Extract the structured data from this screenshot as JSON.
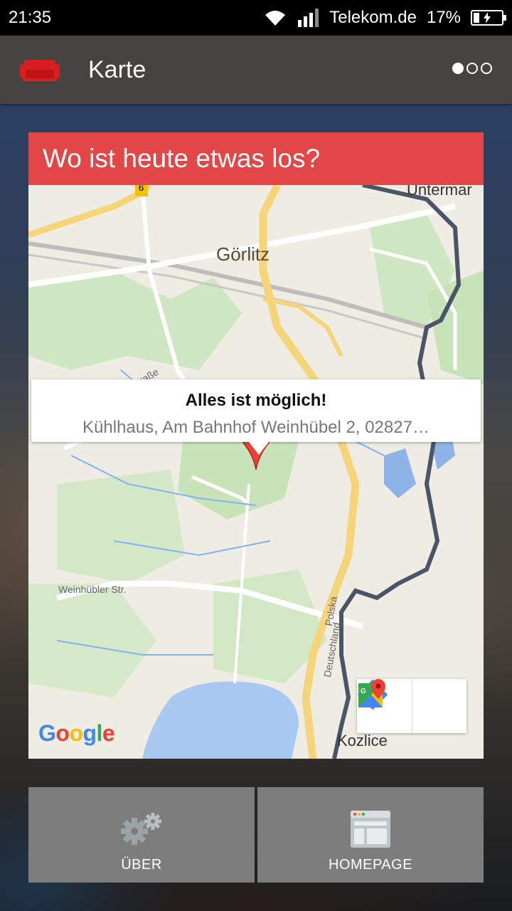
{
  "status_bar": {
    "time": "21:35",
    "carrier": "Telekom.de",
    "battery": "17%"
  },
  "action_bar": {
    "title": "Karte",
    "app_icon": "sofa-icon",
    "page_indicator": {
      "count": 3,
      "active": 1
    }
  },
  "card": {
    "title": "Wo ist heute etwas los?"
  },
  "map": {
    "info_window": {
      "title": "Alles ist möglich!",
      "address": "Kühlhaus, Am Bahnhof Weinhübel 2, 02827…"
    },
    "labels": {
      "city": "Görlitz",
      "town": "Kozlice",
      "poi": "Untermar",
      "street_1": "Promenadenstraße",
      "street_2": "Weinhübler Str.",
      "border_de": "Deutschland",
      "border_pl": "Polska",
      "road_number": "6"
    },
    "buttons": [
      "directions-icon",
      "google-maps-icon"
    ],
    "attribution": "Google"
  },
  "bottom_buttons": {
    "about": {
      "label": "ÜBER",
      "icon": "gears-icon"
    },
    "homepage": {
      "label": "HOMEPAGE",
      "icon": "browser-window-icon"
    }
  },
  "colors": {
    "accent": "#e24646",
    "action_bar": "#474340",
    "button_bg": "#7d7d7d"
  }
}
